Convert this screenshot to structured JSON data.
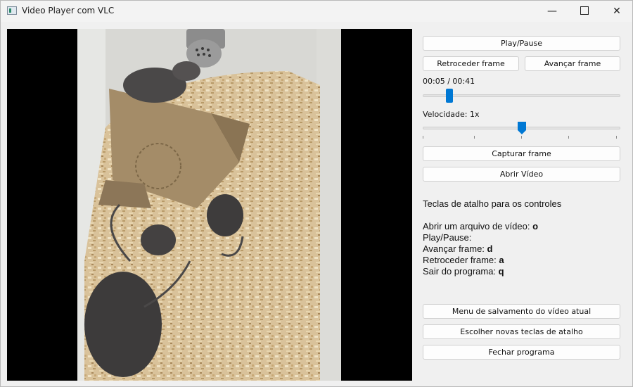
{
  "window": {
    "title": "Video Player com VLC",
    "min_glyph": "—",
    "close_glyph": "✕"
  },
  "controls": {
    "play_pause": "Play/Pause",
    "back_frame": "Retroceder frame",
    "forward_frame": "Avançar frame",
    "time_display": "00:05 / 00:41",
    "time_progress": 0.122,
    "speed_label": "Velocidade: 1x",
    "speed_value": 0.5,
    "capture_frame": "Capturar frame",
    "open_video": "Abrir Vídeo"
  },
  "shortcuts": {
    "title": "Teclas de atalho para os controles",
    "items": [
      {
        "label": "Abrir um arquivo de vídeo: ",
        "key": "o"
      },
      {
        "label": "Play/Pause: ",
        "key": ""
      },
      {
        "label": "Avançar frame: ",
        "key": "d"
      },
      {
        "label": "Retroceder frame: ",
        "key": "a"
      },
      {
        "label": "Sair do programa: ",
        "key": "q"
      }
    ]
  },
  "bottom": {
    "save_menu": "Menu de salvamento do vídeo atual",
    "new_shortcuts": "Escolher novas teclas de atalho",
    "close_program": "Fechar programa"
  },
  "colors": {
    "accent": "#0078d4"
  },
  "icons": {
    "app": "video-player-app-icon",
    "minimize": "minimize-icon",
    "maximize": "maximize-icon",
    "close": "close-icon"
  }
}
